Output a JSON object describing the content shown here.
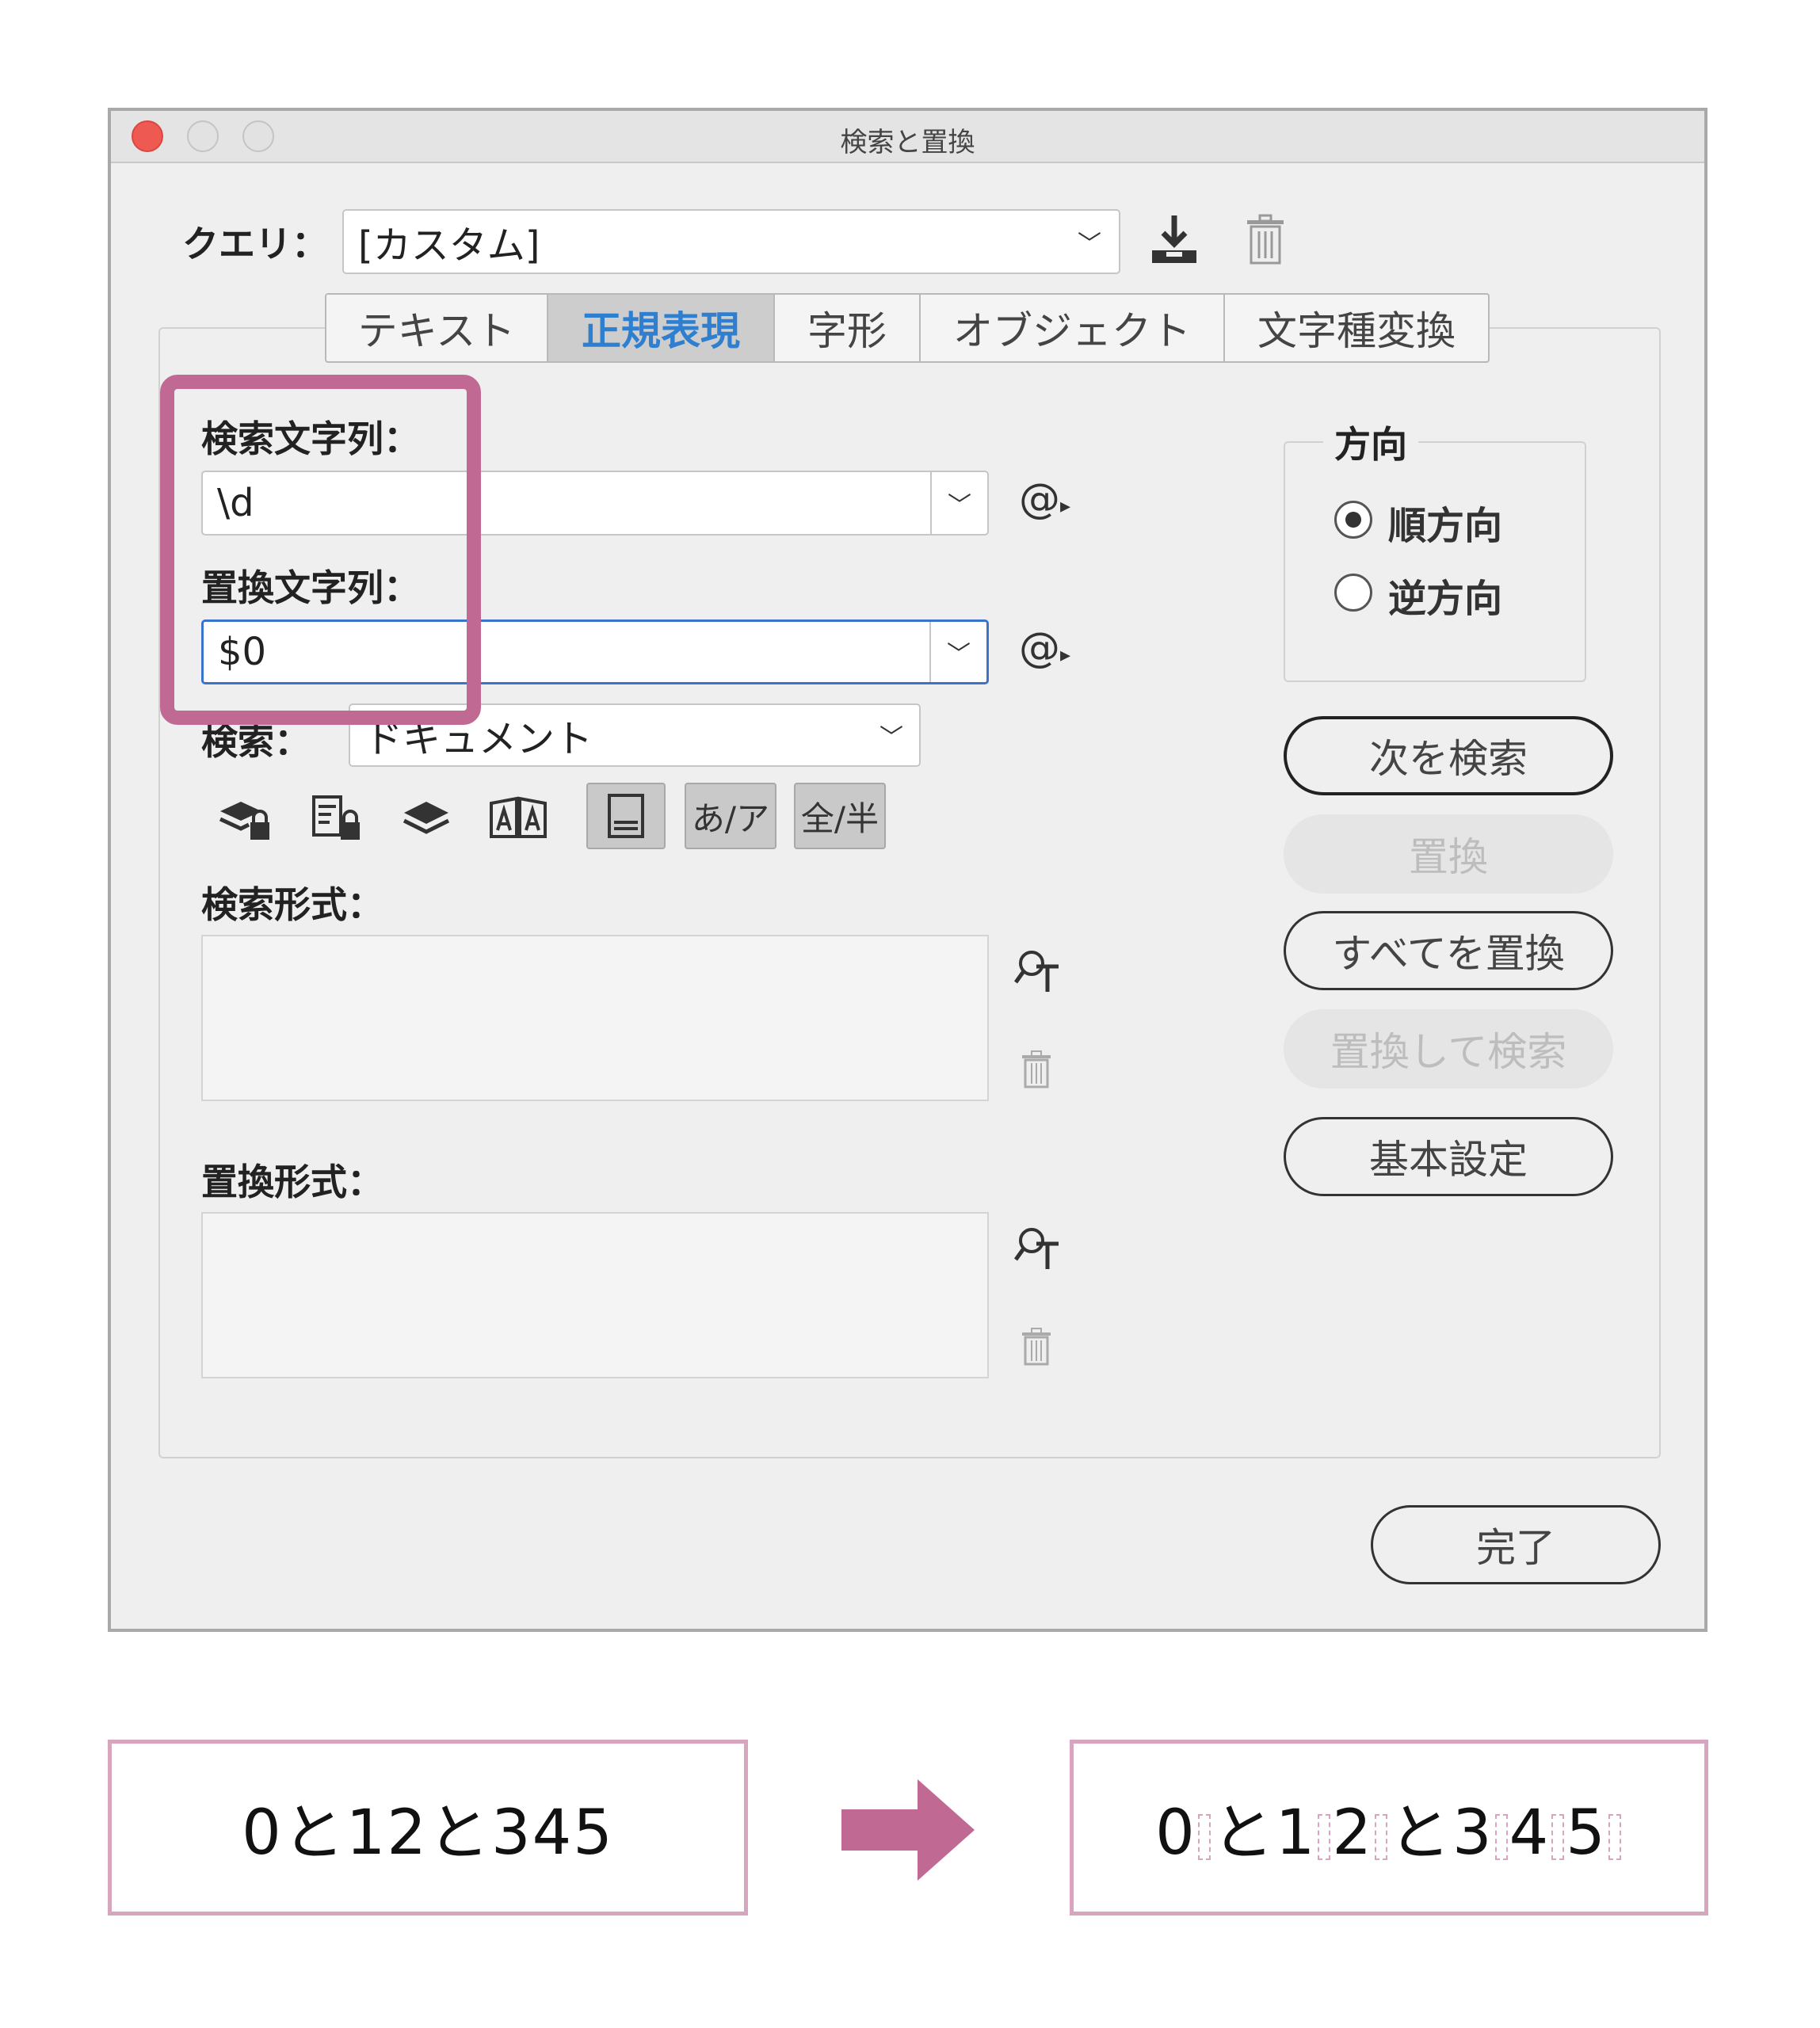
{
  "window": {
    "title": "検索と置換"
  },
  "query": {
    "label": "クエリ：",
    "value": "[カスタム]"
  },
  "tabs": [
    {
      "label": "テキスト",
      "active": false
    },
    {
      "label": "正規表現",
      "active": true
    },
    {
      "label": "字形",
      "active": false
    },
    {
      "label": "オブジェクト",
      "active": false
    },
    {
      "label": "文字種変換",
      "active": false
    }
  ],
  "find": {
    "label": "検索文字列：",
    "value": "\\d",
    "special_char_icon": "@"
  },
  "replace": {
    "label": "置換文字列：",
    "value": "$0",
    "special_char_icon": "@"
  },
  "search_scope": {
    "label": "検索：",
    "value": "ドキュメント"
  },
  "options_toggles": [
    {
      "icon": "locked-layers-icon",
      "glyph": "🔒",
      "on": false
    },
    {
      "icon": "locked-stories-icon",
      "glyph": "🔒",
      "on": false
    },
    {
      "icon": "hidden-layers-icon",
      "glyph": "≋",
      "on": false
    },
    {
      "icon": "master-pages-icon",
      "glyph": "▥",
      "on": false
    },
    {
      "icon": "footnotes-icon",
      "glyph": "▤",
      "on": true
    },
    {
      "label": "あ/ア",
      "on": true
    },
    {
      "label": "全/半",
      "on": true
    }
  ],
  "find_format": {
    "label": "検索形式："
  },
  "change_format": {
    "label": "置換形式："
  },
  "direction": {
    "legend": "方向",
    "options": [
      {
        "label": "順方向",
        "checked": true
      },
      {
        "label": "逆方向",
        "checked": false
      }
    ]
  },
  "buttons": {
    "find_next": "次を検索",
    "change": "置換",
    "change_all": "すべてを置換",
    "change_find": "置換して検索",
    "more_options": "基本設定",
    "done": "完了"
  },
  "example": {
    "before": "0と12と345",
    "after_chars": [
      "0",
      "と",
      "1",
      "2",
      "と",
      "3",
      "4",
      "5"
    ],
    "after_marker_after_index": [
      0,
      2,
      3,
      5,
      6,
      7
    ]
  },
  "colors": {
    "accent_tab": "#2f7fd0",
    "highlight": "#c06a93",
    "example_border": "#d7a6be",
    "arrow": "#c06a93",
    "close_button": "#ee5a52"
  }
}
